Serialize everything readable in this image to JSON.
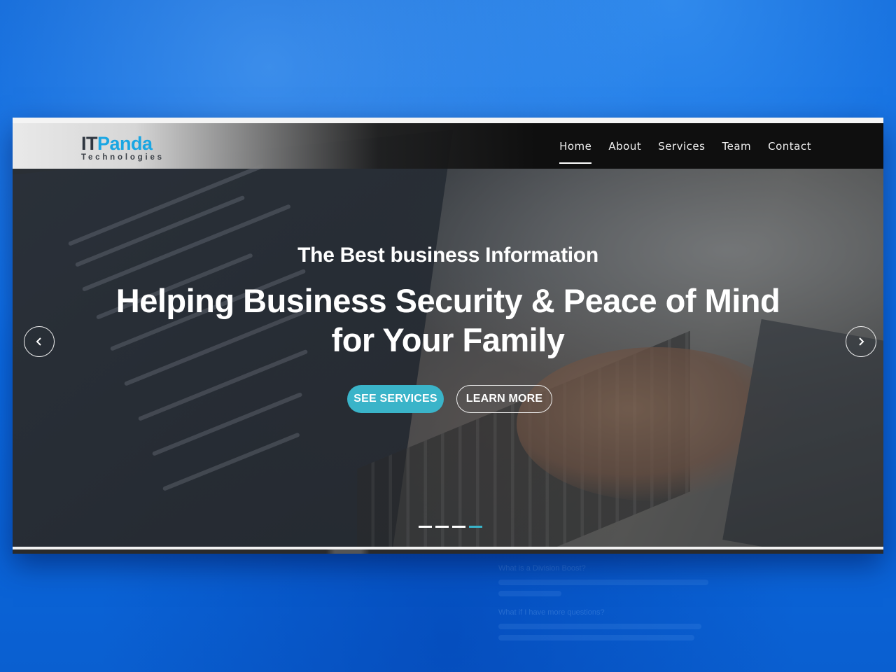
{
  "brand": {
    "name_part1": "IT",
    "name_part2": "Panda",
    "tagline": "Technologies"
  },
  "nav": {
    "items": [
      {
        "label": "Home",
        "active": true
      },
      {
        "label": "About",
        "active": false
      },
      {
        "label": "Services",
        "active": false
      },
      {
        "label": "Team",
        "active": false
      },
      {
        "label": "Contact",
        "active": false
      }
    ]
  },
  "hero": {
    "subtitle": "The Best business Information",
    "title_line1": "Helping Business Security & Peace of Mind",
    "title_line2": "for Your Family",
    "primary_button": "SEE SERVICES",
    "secondary_button": "LEARN MORE"
  },
  "carousel": {
    "slide_count": 4,
    "active_index": 3,
    "prev_icon": "chevron-left-icon",
    "next_icon": "chevron-right-icon"
  },
  "background_text": {
    "question1": "What is a Division Boost?",
    "question2": "What if I have more questions?"
  },
  "colors": {
    "accent": "#3ab4c9",
    "brand_blue": "#1aa6e3",
    "page_background": "#0b6ee8"
  }
}
